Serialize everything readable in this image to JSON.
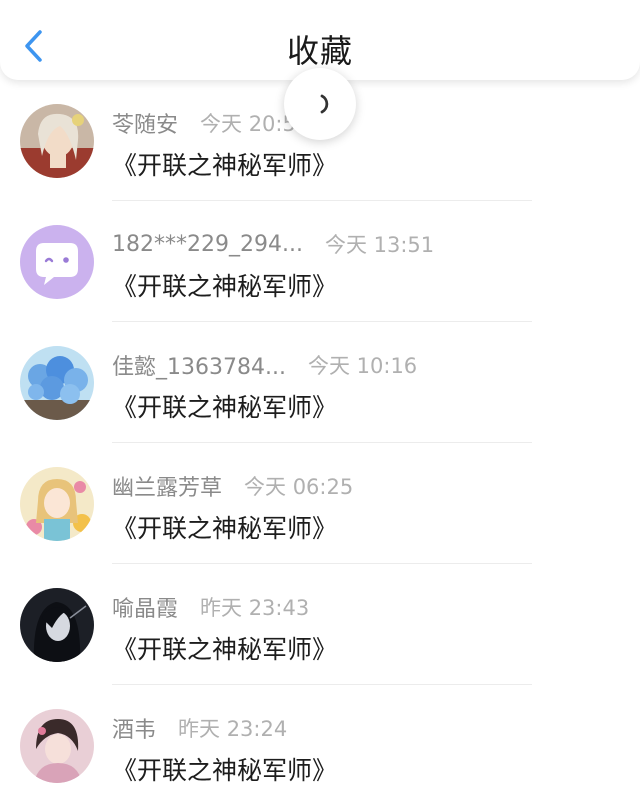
{
  "header": {
    "title": "收藏",
    "back_icon": "chevron-left-icon",
    "accent_color": "#3d95f0"
  },
  "loading": {
    "icon": "loading-spinner-icon"
  },
  "favorites": [
    {
      "username": "苓随安",
      "time": "今天 20:5",
      "title": "《开联之神秘军师》",
      "avatar_icon": "anime-girl-avatar-icon"
    },
    {
      "username": "182***229_294...",
      "time": "今天 13:51",
      "title": "《开联之神秘军师》",
      "avatar_icon": "chat-bubble-avatar-icon"
    },
    {
      "username": "佳懿_1363784...",
      "time": "今天 10:16",
      "title": "《开联之神秘军师》",
      "avatar_icon": "blue-flowers-avatar-icon"
    },
    {
      "username": "幽兰露芳草",
      "time": "今天 06:25",
      "title": "《开联之神秘军师》",
      "avatar_icon": "anime-girl-avatar-icon"
    },
    {
      "username": "喻晶霞",
      "time": "昨天 23:43",
      "title": "《开联之神秘军师》",
      "avatar_icon": "dark-portrait-avatar-icon"
    },
    {
      "username": "酒韦",
      "time": "昨天 23:24",
      "title": "《开联之神秘军师》",
      "avatar_icon": "girl-portrait-avatar-icon"
    }
  ]
}
